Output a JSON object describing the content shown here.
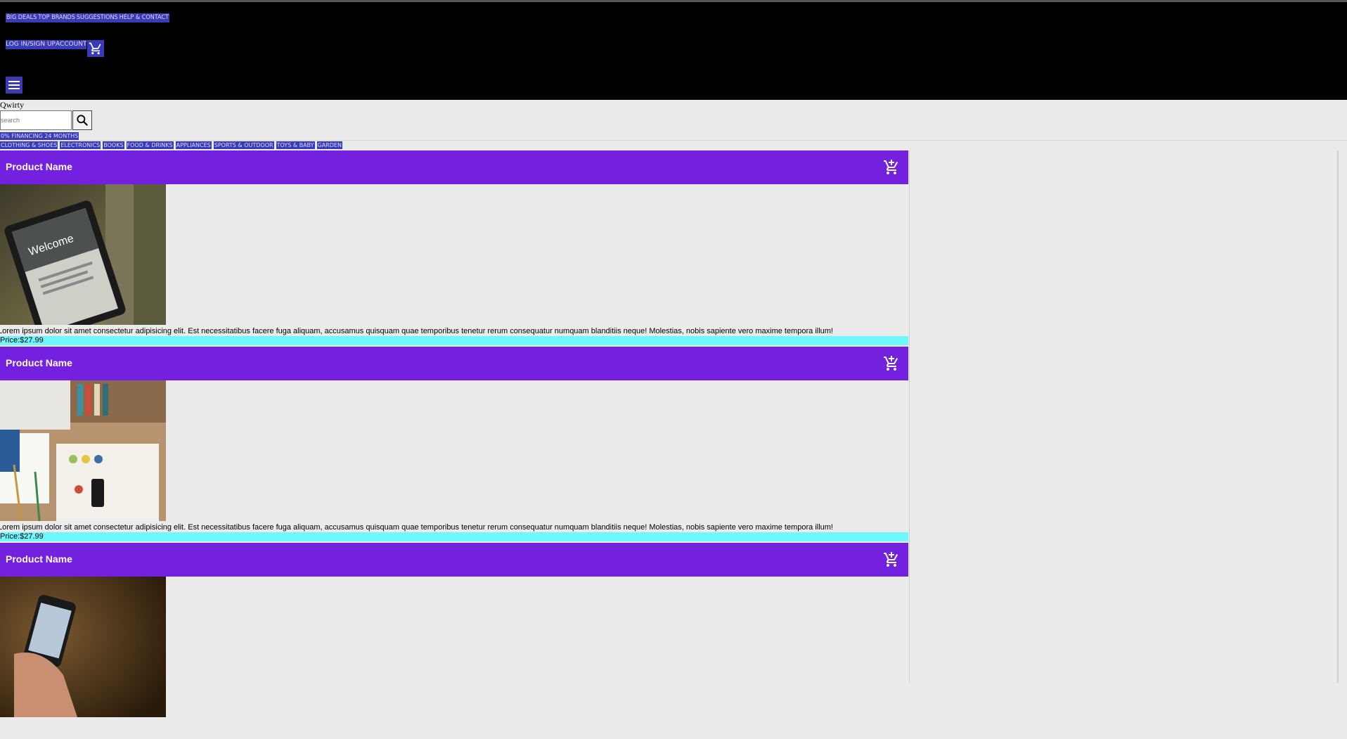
{
  "header": {
    "top_links": [
      "BIG DEALS",
      "TOP BRANDS",
      "SUGGESTIONS",
      "HELP & CONTACT"
    ],
    "login": "LOG IN/SIGN UP",
    "account": "ACCOUNT"
  },
  "brand": "Qwirty",
  "search": {
    "placeholder": "search"
  },
  "promo": "0% FINANCING 24 MONTHS",
  "categories": [
    "CLOTHING & SHOES",
    "ELECTRONICS",
    "BOOKS",
    "FOOD & DRINKS",
    "APPLIANCES",
    "SPORTS & OUTDOOR",
    "TOYS & BABY",
    "GARDEN"
  ],
  "products": [
    {
      "name": "Product Name",
      "image": "tablet-on-books",
      "description": "Lorem ipsum dolor sit amet consectetur adipisicing elit. Est necessitatibus facere fuga aliquam, accusamus quisquam quae temporibus tenetur rerum consequatur numquam blanditiis neque! Molestias, nobis sapiente vero maxime tempora illum!",
      "price": "Price:$27.99"
    },
    {
      "name": "Product Name",
      "image": "desk-laptop-notebook",
      "description": "Lorem ipsum dolor sit amet consectetur adipisicing elit. Est necessitatibus facere fuga aliquam, accusamus quisquam quae temporibus tenetur rerum consequatur numquam blanditiis neque! Molestias, nobis sapiente vero maxime tempora illum!",
      "price": "Price:$27.99"
    },
    {
      "name": "Product Name",
      "image": "hand-holding-phone",
      "description": "",
      "price": ""
    }
  ],
  "colors": {
    "topbar": "#000000",
    "link_bg": "#3b3bb8",
    "product_header": "#7420df",
    "price_bg": "#6ff7ff",
    "page_bg": "#ebebeb"
  }
}
